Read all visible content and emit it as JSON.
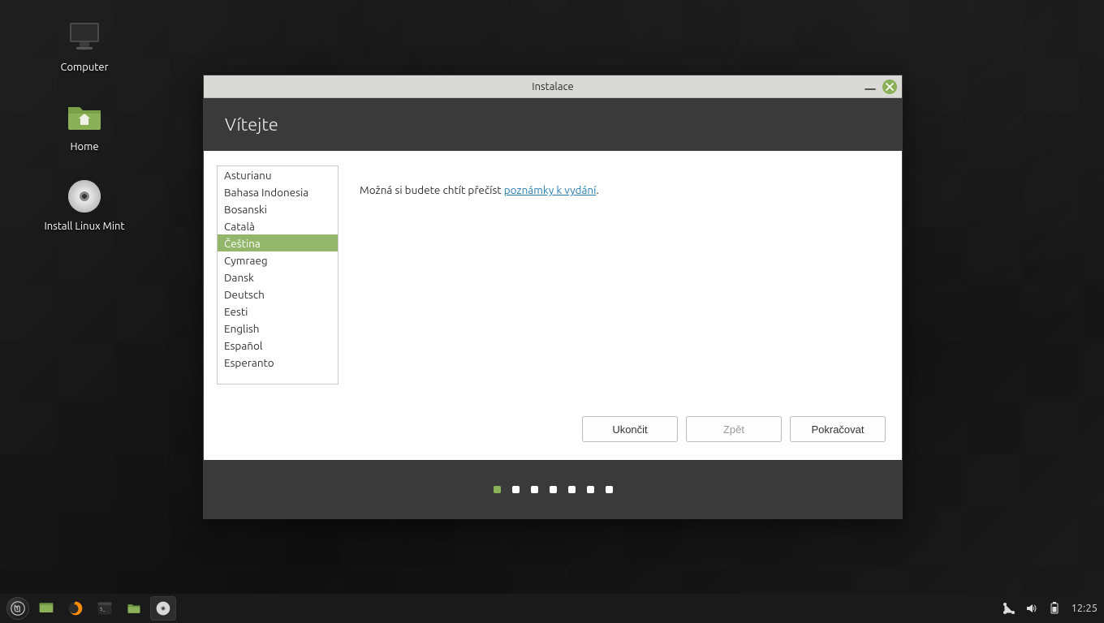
{
  "desktop": {
    "icons": [
      {
        "name": "computer",
        "label": "Computer"
      },
      {
        "name": "home",
        "label": "Home"
      },
      {
        "name": "install",
        "label": "Install Linux Mint"
      }
    ]
  },
  "window": {
    "title": "Instalace",
    "header": "Vítejte",
    "note_prefix": "Možná si budete chtít přečíst ",
    "note_link": "poznámky k vydání",
    "note_suffix": ".",
    "languages": [
      "Asturianu",
      "Bahasa Indonesia",
      "Bosanski",
      "Català",
      "Čeština",
      "Cymraeg",
      "Dansk",
      "Deutsch",
      "Eesti",
      "English",
      "Español",
      "Esperanto"
    ],
    "selected_language_index": 4,
    "buttons": {
      "quit": "Ukončit",
      "back": "Zpět",
      "continue": "Pokračovat"
    },
    "page_count": 7,
    "current_page": 0
  },
  "panel": {
    "clock": "12:25"
  }
}
